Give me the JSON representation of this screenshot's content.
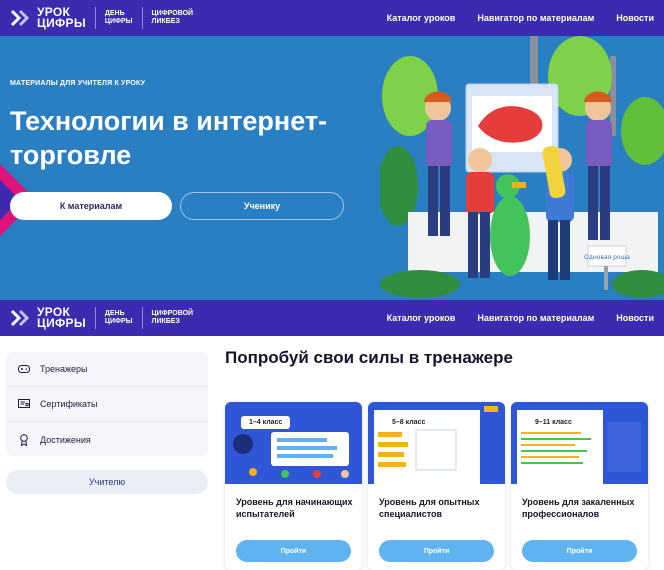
{
  "header": {
    "logo_line1": "УРОК",
    "logo_line2": "ЦИФРЫ",
    "day_line1": "ДЕНЬ",
    "day_line2": "ЦИФРЫ",
    "likbez_line1": "ЦИФРОВОЙ",
    "likbez_line2": "ЛИКБЕЗ",
    "nav": [
      "Каталог уроков",
      "Навигатор по материалам",
      "Новости"
    ]
  },
  "hero": {
    "kicker": "МАТЕРИАЛЫ ДЛЯ УЧИТЕЛЯ К УРОКУ",
    "title": "Технологии в интернет-торговле",
    "primary_button": "К материалам",
    "secondary_button": "Ученику",
    "sign_text": "Одновая роща"
  },
  "sidebar": {
    "items": [
      {
        "label": "Тренажеры",
        "icon": "gamepad-icon"
      },
      {
        "label": "Сертификаты",
        "icon": "certificate-icon"
      },
      {
        "label": "Достижения",
        "icon": "medal-icon"
      }
    ],
    "teacher_button": "Учителю"
  },
  "trainers": {
    "title": "Попробуй свои силы в тренажере",
    "cards": [
      {
        "grade": "1–4 класс",
        "title": "Уровень для начинающих испытателей",
        "button": "Пройти"
      },
      {
        "grade": "5–8 класс",
        "title": "Уровень для опытных специалистов",
        "button": "Пройти"
      },
      {
        "grade": "9–11 класс",
        "title": "Уровень для закаленных профессионалов",
        "button": "Пройти"
      }
    ]
  },
  "colors": {
    "header_bg": "#3b2bb0",
    "hero_bg": "#2a7fc3",
    "accent_pink": "#e0137a",
    "button_blue": "#5fb4f0"
  }
}
